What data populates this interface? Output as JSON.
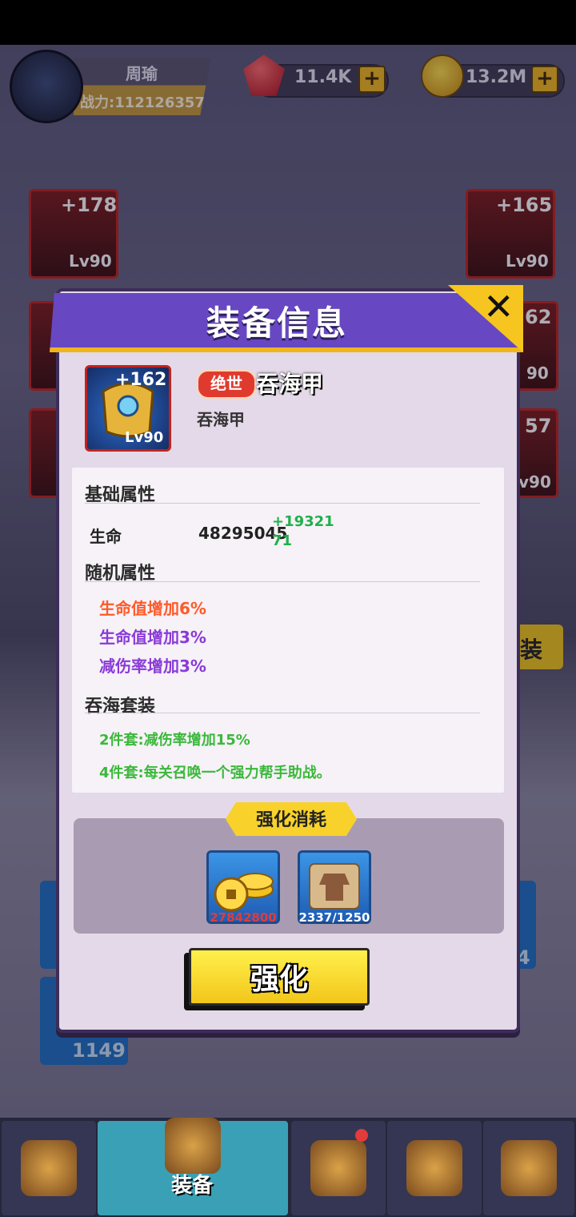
{
  "header": {
    "player_name": "周瑜",
    "power_text": "战力:112126357",
    "gems": "11.4K",
    "gold": "13.2M",
    "plus": "+"
  },
  "slots": [
    {
      "plus": "+178",
      "level": "Lv90"
    },
    {
      "plus": "+165",
      "level": "Lv90"
    },
    {
      "plus": "62",
      "level": "90"
    },
    {
      "plus": "57",
      "level": "v90"
    }
  ],
  "modal": {
    "title": "装备信息",
    "close": "✕",
    "item": {
      "plus": "+162",
      "level": "Lv90",
      "rarity": "绝世",
      "name": "吞海甲",
      "subtitle": "吞海甲"
    },
    "base_section": "基础属性",
    "hp_label": "生命",
    "hp_value": "48295045",
    "hp_bonus": "+1932171",
    "random_section": "随机属性",
    "random_attrs": [
      {
        "text": "生命值增加6%",
        "color": "#ff5a2a"
      },
      {
        "text": "生命值增加3%",
        "color": "#8a3ad9"
      },
      {
        "text": "减伤率增加3%",
        "color": "#8a3ad9"
      }
    ],
    "set_section": "吞海套装",
    "set_bonuses": [
      "2件套:减伤率增加15%",
      "4件套:每关召唤一个强力帮手助战。"
    ],
    "cost_title": "强化消耗",
    "costs": [
      {
        "value": "27842800",
        "color": "#e23b3b",
        "icon": "gold-coins-icon"
      },
      {
        "value": "2337/1250",
        "color": "#ffffff",
        "icon": "armor-scroll-icon"
      }
    ],
    "upgrade_label": "强化"
  },
  "background": {
    "side_button": "装",
    "left_count": "1149",
    "right_digit": "4"
  },
  "nav": {
    "active_label": "装备"
  }
}
